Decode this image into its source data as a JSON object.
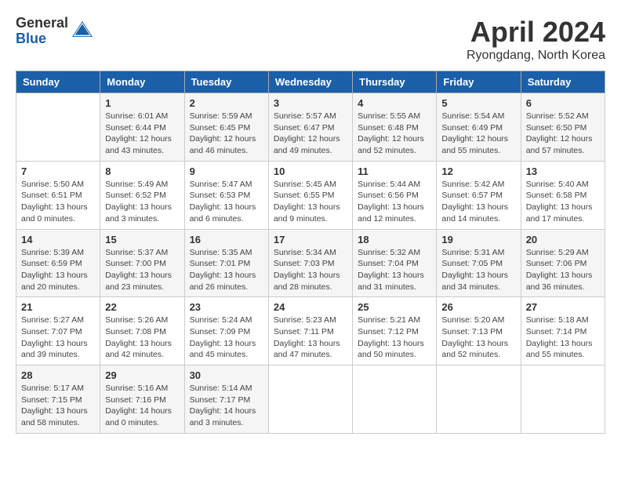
{
  "logo": {
    "general": "General",
    "blue": "Blue"
  },
  "title": "April 2024",
  "location": "Ryongdang, North Korea",
  "days_header": [
    "Sunday",
    "Monday",
    "Tuesday",
    "Wednesday",
    "Thursday",
    "Friday",
    "Saturday"
  ],
  "weeks": [
    [
      {
        "day": "",
        "info": ""
      },
      {
        "day": "1",
        "info": "Sunrise: 6:01 AM\nSunset: 6:44 PM\nDaylight: 12 hours\nand 43 minutes."
      },
      {
        "day": "2",
        "info": "Sunrise: 5:59 AM\nSunset: 6:45 PM\nDaylight: 12 hours\nand 46 minutes."
      },
      {
        "day": "3",
        "info": "Sunrise: 5:57 AM\nSunset: 6:47 PM\nDaylight: 12 hours\nand 49 minutes."
      },
      {
        "day": "4",
        "info": "Sunrise: 5:55 AM\nSunset: 6:48 PM\nDaylight: 12 hours\nand 52 minutes."
      },
      {
        "day": "5",
        "info": "Sunrise: 5:54 AM\nSunset: 6:49 PM\nDaylight: 12 hours\nand 55 minutes."
      },
      {
        "day": "6",
        "info": "Sunrise: 5:52 AM\nSunset: 6:50 PM\nDaylight: 12 hours\nand 57 minutes."
      }
    ],
    [
      {
        "day": "7",
        "info": "Sunrise: 5:50 AM\nSunset: 6:51 PM\nDaylight: 13 hours\nand 0 minutes."
      },
      {
        "day": "8",
        "info": "Sunrise: 5:49 AM\nSunset: 6:52 PM\nDaylight: 13 hours\nand 3 minutes."
      },
      {
        "day": "9",
        "info": "Sunrise: 5:47 AM\nSunset: 6:53 PM\nDaylight: 13 hours\nand 6 minutes."
      },
      {
        "day": "10",
        "info": "Sunrise: 5:45 AM\nSunset: 6:55 PM\nDaylight: 13 hours\nand 9 minutes."
      },
      {
        "day": "11",
        "info": "Sunrise: 5:44 AM\nSunset: 6:56 PM\nDaylight: 13 hours\nand 12 minutes."
      },
      {
        "day": "12",
        "info": "Sunrise: 5:42 AM\nSunset: 6:57 PM\nDaylight: 13 hours\nand 14 minutes."
      },
      {
        "day": "13",
        "info": "Sunrise: 5:40 AM\nSunset: 6:58 PM\nDaylight: 13 hours\nand 17 minutes."
      }
    ],
    [
      {
        "day": "14",
        "info": "Sunrise: 5:39 AM\nSunset: 6:59 PM\nDaylight: 13 hours\nand 20 minutes."
      },
      {
        "day": "15",
        "info": "Sunrise: 5:37 AM\nSunset: 7:00 PM\nDaylight: 13 hours\nand 23 minutes."
      },
      {
        "day": "16",
        "info": "Sunrise: 5:35 AM\nSunset: 7:01 PM\nDaylight: 13 hours\nand 26 minutes."
      },
      {
        "day": "17",
        "info": "Sunrise: 5:34 AM\nSunset: 7:03 PM\nDaylight: 13 hours\nand 28 minutes."
      },
      {
        "day": "18",
        "info": "Sunrise: 5:32 AM\nSunset: 7:04 PM\nDaylight: 13 hours\nand 31 minutes."
      },
      {
        "day": "19",
        "info": "Sunrise: 5:31 AM\nSunset: 7:05 PM\nDaylight: 13 hours\nand 34 minutes."
      },
      {
        "day": "20",
        "info": "Sunrise: 5:29 AM\nSunset: 7:06 PM\nDaylight: 13 hours\nand 36 minutes."
      }
    ],
    [
      {
        "day": "21",
        "info": "Sunrise: 5:27 AM\nSunset: 7:07 PM\nDaylight: 13 hours\nand 39 minutes."
      },
      {
        "day": "22",
        "info": "Sunrise: 5:26 AM\nSunset: 7:08 PM\nDaylight: 13 hours\nand 42 minutes."
      },
      {
        "day": "23",
        "info": "Sunrise: 5:24 AM\nSunset: 7:09 PM\nDaylight: 13 hours\nand 45 minutes."
      },
      {
        "day": "24",
        "info": "Sunrise: 5:23 AM\nSunset: 7:11 PM\nDaylight: 13 hours\nand 47 minutes."
      },
      {
        "day": "25",
        "info": "Sunrise: 5:21 AM\nSunset: 7:12 PM\nDaylight: 13 hours\nand 50 minutes."
      },
      {
        "day": "26",
        "info": "Sunrise: 5:20 AM\nSunset: 7:13 PM\nDaylight: 13 hours\nand 52 minutes."
      },
      {
        "day": "27",
        "info": "Sunrise: 5:18 AM\nSunset: 7:14 PM\nDaylight: 13 hours\nand 55 minutes."
      }
    ],
    [
      {
        "day": "28",
        "info": "Sunrise: 5:17 AM\nSunset: 7:15 PM\nDaylight: 13 hours\nand 58 minutes."
      },
      {
        "day": "29",
        "info": "Sunrise: 5:16 AM\nSunset: 7:16 PM\nDaylight: 14 hours\nand 0 minutes."
      },
      {
        "day": "30",
        "info": "Sunrise: 5:14 AM\nSunset: 7:17 PM\nDaylight: 14 hours\nand 3 minutes."
      },
      {
        "day": "",
        "info": ""
      },
      {
        "day": "",
        "info": ""
      },
      {
        "day": "",
        "info": ""
      },
      {
        "day": "",
        "info": ""
      }
    ]
  ]
}
